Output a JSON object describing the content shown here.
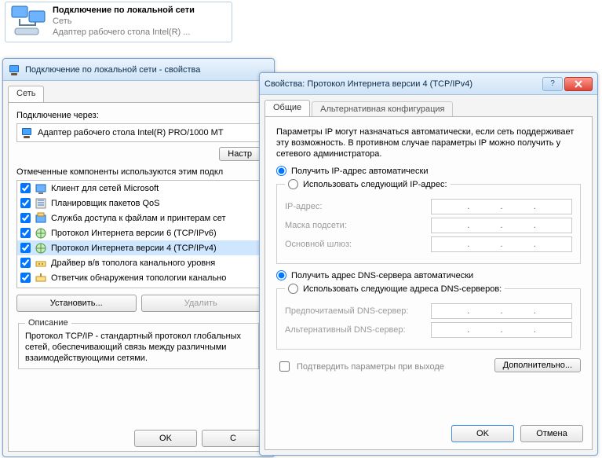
{
  "topConn": {
    "title": "Подключение по локальной сети",
    "line2": "Сеть",
    "line3": "Адаптер рабочего стола Intel(R) ..."
  },
  "leftWin": {
    "title": "Подключение по локальной сети - свойства",
    "tabNet": "Сеть",
    "connectVia": "Подключение через:",
    "adapter": "Адаптер рабочего стола Intel(R) PRO/1000 MT",
    "configureBtn": "Настр",
    "checkedLabel": "Отмеченные компоненты используются этим подкл",
    "components": [
      "Клиент для сетей Microsoft",
      "Планировщик пакетов QoS",
      "Служба доступа к файлам и принтерам сет",
      "Протокол Интернета версии 6 (TCP/IPv6)",
      "Протокол Интернета версии 4 (TCP/IPv4)",
      "Драйвер в/в тополога канального уровня",
      "Ответчик обнаружения топологии канально"
    ],
    "installBtn": "Установить...",
    "uninstallBtn": "Удалить",
    "descLegend": "Описание",
    "descText": "Протокол TCP/IP - стандартный протокол глобальных сетей, обеспечивающий связь между различными взаимодействующими сетями.",
    "ok": "OK",
    "cancel": "С"
  },
  "rightWin": {
    "title": "Свойства: Протокол Интернета версии 4 (TCP/IPv4)",
    "help": "?",
    "tabGeneral": "Общие",
    "tabAlt": "Альтернативная конфигурация",
    "explain": "Параметры IP могут назначаться автоматически, если сеть поддерживает эту возможность. В противном случае параметры IP можно получить у сетевого администратора.",
    "rAutoIP": "Получить IP-адрес автоматически",
    "rManualIP": "Использовать следующий IP-адрес:",
    "ipLabel": "IP-адрес:",
    "maskLabel": "Маска подсети:",
    "gatewayLabel": "Основной шлюз:",
    "rAutoDNS": "Получить адрес DNS-сервера автоматически",
    "rManualDNS": "Использовать следующие адреса DNS-серверов:",
    "prefDNS": "Предпочитаемый DNS-сервер:",
    "altDNS": "Альтернативный DNS-сервер:",
    "confirmExit": "Подтвердить параметры при выходе",
    "advanced": "Дополнительно...",
    "ok": "OK",
    "cancel": "Отмена"
  }
}
